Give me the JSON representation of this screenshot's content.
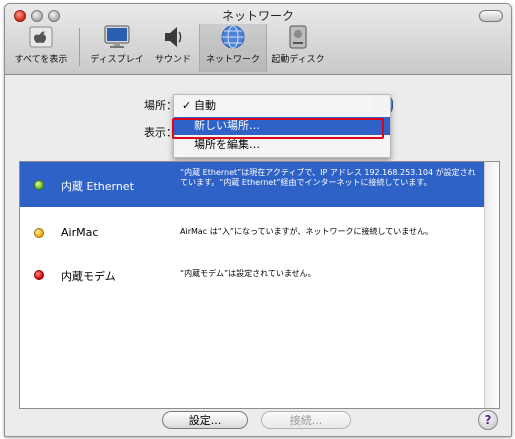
{
  "window": {
    "title": "ネットワーク"
  },
  "toolbar": {
    "items": [
      {
        "label": "すべてを表示",
        "icon": "show-all-icon"
      },
      {
        "label": "ディスプレイ",
        "icon": "display-icon"
      },
      {
        "label": "サウンド",
        "icon": "sound-icon"
      },
      {
        "label": "ネットワーク",
        "icon": "network-icon"
      },
      {
        "label": "起動ディスク",
        "icon": "startup-disk-icon"
      }
    ]
  },
  "location": {
    "label": "場所：",
    "show_label": "表示："
  },
  "location_menu": {
    "items": [
      {
        "label": "自動",
        "checked": true,
        "check_mark": "✓"
      },
      {
        "label": "新しい場所…",
        "highlighted": true
      },
      {
        "label": "場所を編集…"
      }
    ]
  },
  "services": [
    {
      "name": "内蔵 Ethernet",
      "status": "green",
      "description": "“内蔵 Ethernet”は現在アクティブで、IP アドレス 192.168.253.104 が設定されています。“内蔵 Ethernet”経由でインターネットに接続しています。",
      "selected": true
    },
    {
      "name": "AirMac",
      "status": "yellow",
      "description": "AirMac は“入”になっていますが、ネットワークに接続していません。"
    },
    {
      "name": "内蔵モデム",
      "status": "red",
      "description": "“内蔵モデム”は設定されていません。"
    }
  ],
  "buttons": {
    "configure": "設定...",
    "connect": "接続...",
    "help": "?"
  },
  "colors": {
    "selection": "#2f62c7",
    "highlight_box": "#e0001a"
  }
}
